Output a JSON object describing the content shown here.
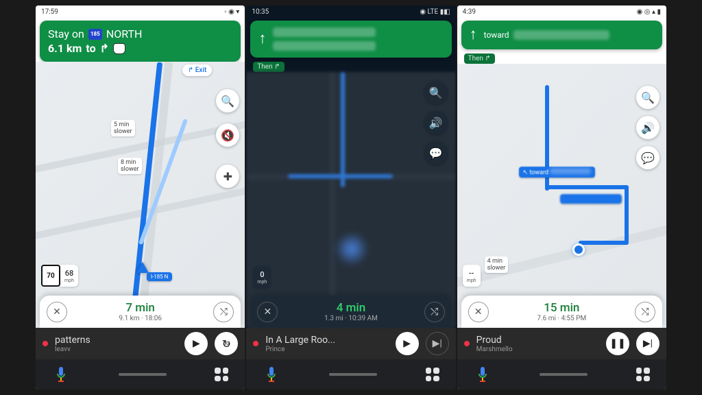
{
  "screens": [
    {
      "status": {
        "time": "17:59",
        "right": "◦ ◉ ▾"
      },
      "banner": {
        "line1_prefix": "Stay on",
        "highway_shield": "185",
        "line1_suffix": "NORTH",
        "distance": "6.1 km",
        "to_word": "to"
      },
      "exit_chip": "↱ Exit",
      "callouts": {
        "c1": "5 min\nslower",
        "c2": "8 min\nslower"
      },
      "speed": {
        "limit": "70",
        "current": "68",
        "unit": "mph"
      },
      "eta": {
        "time": "7 min",
        "detail": "9.1 km  ·  18:06"
      },
      "media": {
        "title": "patterns",
        "artist": "leavv",
        "play": "▶",
        "aux_icon": "replay-30"
      },
      "route_chip": "I-185 N"
    },
    {
      "status": {
        "time": "10:35",
        "right": "◉ LTE ▮◧"
      },
      "then": "Then ↱",
      "speed": {
        "current": "0",
        "unit": "mph"
      },
      "eta": {
        "time": "4 min",
        "detail": "1.3 mi  ·  10:39 AM"
      },
      "media": {
        "title": "In A Large Roo...",
        "artist": "Prince",
        "play": "▶",
        "aux_icon": "skip-next-disabled"
      }
    },
    {
      "status": {
        "time": "4:39",
        "right": "◉ ◎ ▴ ▮"
      },
      "banner_toward": "toward",
      "then": "Then ↱",
      "callouts": {
        "c1": "↖ toward",
        "c2": "4 min\nslower"
      },
      "speed": {
        "current": "--",
        "unit": "mph"
      },
      "eta": {
        "time": "15 min",
        "detail": "7.6 mi  ·  4:55 PM"
      },
      "media": {
        "title": "Proud",
        "artist": "Marshmello",
        "play": "❚❚",
        "aux_icon": "skip-next"
      }
    }
  ]
}
